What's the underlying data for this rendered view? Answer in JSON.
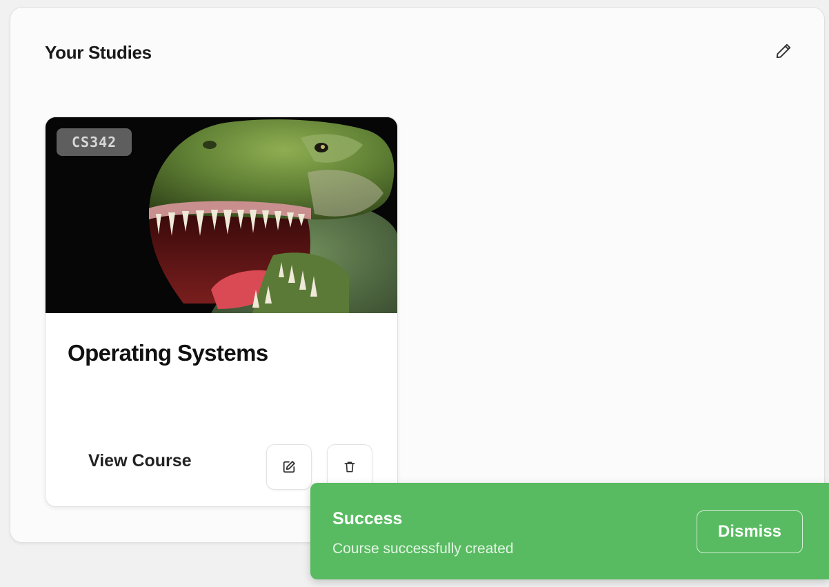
{
  "panel": {
    "title": "Your Studies",
    "edit_icon": "pencil-icon"
  },
  "course_card": {
    "code": "CS342",
    "title": "Operating Systems",
    "image": "dinosaur-photo",
    "view_label": "View Course",
    "edit_icon": "edit-square-icon",
    "delete_icon": "trash-icon"
  },
  "toast": {
    "title": "Success",
    "message": "Course successfully created",
    "dismiss_label": "Dismiss",
    "color": "#58bb61"
  }
}
